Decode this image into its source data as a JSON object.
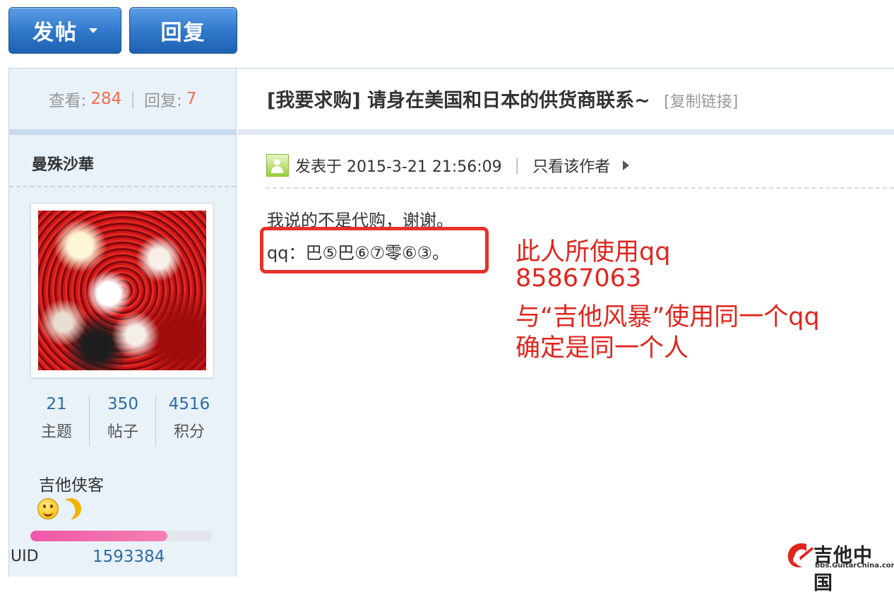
{
  "toolbar": {
    "post_label": "发帖",
    "reply_label": "回复"
  },
  "thread_stats": {
    "views_label": "查看:",
    "views": "284",
    "replies_label": "回复:",
    "replies": "7"
  },
  "thread": {
    "title": "[我要求购] 请身在美国和日本的供货商联系~",
    "copy_link": "[复制链接]"
  },
  "author": {
    "name": "曼殊沙華",
    "stats": [
      {
        "value": "21",
        "label": "主题"
      },
      {
        "value": "350",
        "label": "帖子"
      },
      {
        "value": "4516",
        "label": "积分"
      }
    ],
    "rank": "吉他侠客",
    "level_progress": 0.75,
    "uid_label": "UID",
    "uid": "1593384"
  },
  "post": {
    "meta": "发表于 2015-3-21 21:56:09",
    "author_only": "只看该作者",
    "line1": "我说的不是代购，谢谢。",
    "line2": "qq：巴⑤巴⑥⑦零⑥③。"
  },
  "annotation": {
    "lines": [
      "此人所使用qq",
      "85867063",
      "与“吉他风暴”使用同一个qq",
      "确定是同一个人"
    ],
    "color": "#e0251d"
  },
  "watermark": {
    "name": "吉他中国",
    "url": "bbs.GuitarChina.com"
  },
  "colors": {
    "accent": "#2f76c9",
    "stat_number": "#f26c4f",
    "link_blue": "#2d6ca8"
  },
  "icons": [
    "caret-down-icon",
    "post-avatar-icon",
    "arrow-right-icon",
    "smile-emoji-icon",
    "moon-icon",
    "guitar-logo-icon"
  ]
}
